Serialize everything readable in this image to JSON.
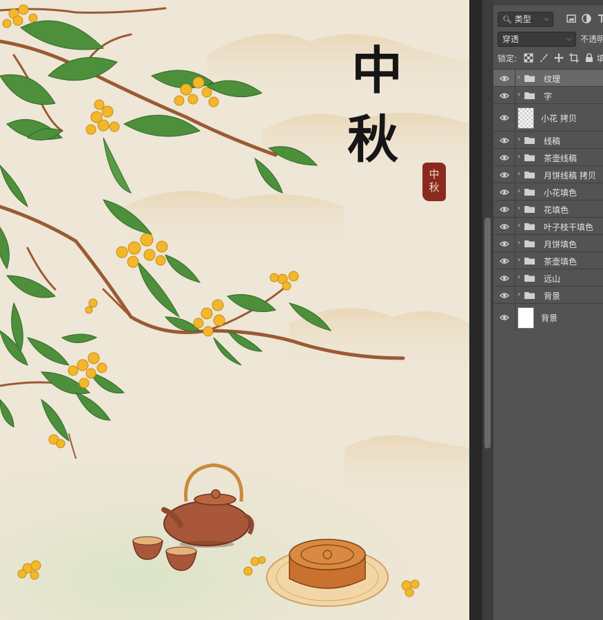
{
  "artwork": {
    "title_chars": [
      "中",
      "秋"
    ],
    "seal_text": "中秋",
    "colors": {
      "paper": "#eee6d6",
      "leaf": "#4d8f3a",
      "flower": "#f2b72a",
      "branch": "#9a5a33",
      "seal": "#8a2a1e"
    }
  },
  "layers_panel": {
    "filter_kind": "类型",
    "blend_mode": "穿透",
    "opacity_label": "不透明",
    "lock_label": "锁定:",
    "fill_label": "填",
    "layers": [
      {
        "name": "纹理",
        "type": "group",
        "visible": true,
        "selected": true
      },
      {
        "name": "字",
        "type": "group",
        "visible": true
      },
      {
        "name": "小花 拷贝",
        "type": "pixel",
        "thumbnail": "transparent",
        "visible": true
      },
      {
        "name": "线稿",
        "type": "group",
        "visible": true
      },
      {
        "name": "茶壶线稿",
        "type": "group",
        "visible": true
      },
      {
        "name": "月饼线稿 拷贝",
        "type": "group",
        "visible": true
      },
      {
        "name": "小花填色",
        "type": "group",
        "visible": true
      },
      {
        "name": "花填色",
        "type": "group",
        "visible": true
      },
      {
        "name": "叶子枝干填色",
        "type": "group",
        "visible": true
      },
      {
        "name": "月饼填色",
        "type": "group",
        "visible": true
      },
      {
        "name": "茶壶填色",
        "type": "group",
        "visible": true
      },
      {
        "name": "远山",
        "type": "group",
        "visible": true
      },
      {
        "name": "背景",
        "type": "group",
        "visible": true
      },
      {
        "name": "背景",
        "type": "pixel",
        "thumbnail": "white",
        "visible": true
      }
    ]
  }
}
